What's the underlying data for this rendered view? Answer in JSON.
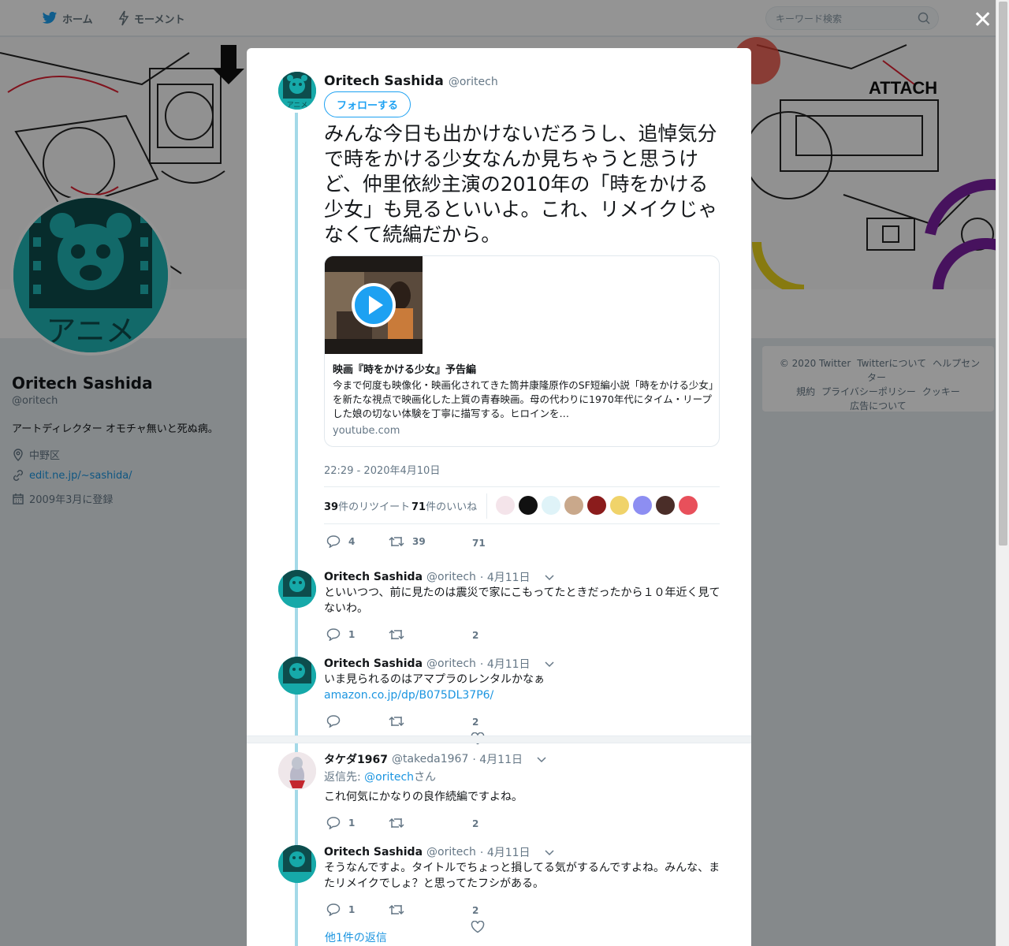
{
  "topnav": {
    "home": "ホーム",
    "moments": "モーメント",
    "search_placeholder": "キーワード検索"
  },
  "profile": {
    "name": "Oritech Sashida",
    "handle": "@oritech",
    "avatar_text": "アニメ",
    "bio": "アートディレクター オモチャ無いと死ぬ病。",
    "location": "中野区",
    "url": "edit.ne.jp/~sashida/",
    "joined": "2009年3月に登録"
  },
  "banner": {
    "label": "ATTACH"
  },
  "footer": {
    "links": [
      "© 2020 Twitter",
      "Twitterについて",
      "ヘルプセンター",
      "規約",
      "プライバシーポリシー",
      "クッキー",
      "広告について"
    ]
  },
  "tweet": {
    "name": "Oritech Sashida",
    "handle": "@oritech",
    "follow": "フォローする",
    "text": "みんな今日も出かけないだろうし、追悼気分で時をかける少女なんか見ちゃうと思うけど、仲里依紗主演の2010年の「時をかける少女」も見るといいよ。これ、リメイクじゃなくて続編だから。",
    "card": {
      "title": "映画『時をかける少女』予告編",
      "description": "今まで何度も映像化・映画化されてきた筒井康隆原作のSF短編小説「時をかける少女」を新たな視点で映画化した上質の青春映画。母の代わりに1970年代にタイム・リープした娘の切ない体験を丁寧に描写する。ヒロインを…",
      "url": "youtube.com"
    },
    "timestamp": "22:29 - 2020年4月10日",
    "retweets_count": "39",
    "retweets_label": "件のリツイート",
    "likes_count": "71",
    "likes_label": "件のいいね",
    "actions": {
      "reply": "4",
      "retweet": "39",
      "like": "71"
    }
  },
  "replies": [
    {
      "name": "Oritech Sashida",
      "handle": "@oritech",
      "date": "· 4月11日",
      "text": "といいつつ、前に見たのは震災で家にこもってたときだったから１０年近く見てないわ。",
      "reply": "1",
      "retweet": "",
      "like": "2"
    },
    {
      "name": "Oritech Sashida",
      "handle": "@oritech",
      "date": "· 4月11日",
      "text": "いま見られるのはアマプラのレンタルかなぁ",
      "link": "amazon.co.jp/dp/B075DL37P6/",
      "reply": "",
      "retweet": "",
      "like": "2"
    },
    {
      "name": "タケダ1967",
      "handle": "@takeda1967",
      "date": "· 4月11日",
      "reply_to_prefix": "返信先: ",
      "reply_to_handle": "@oritech",
      "reply_to_suffix": "さん",
      "text": "これ何気にかなりの良作続編ですよね。",
      "reply": "1",
      "retweet": "",
      "like": "2"
    },
    {
      "name": "Oritech Sashida",
      "handle": "@oritech",
      "date": "· 4月11日",
      "text": "そうなんですよ。タイトルでちょっと損してる気がするんですよね。みんな、またリメイクでしょ？と思ってたフシがある。",
      "reply": "1",
      "retweet": "",
      "like": "2"
    }
  ],
  "more_replies": "他1件の返信",
  "colors": {
    "accent": "#1da1f2",
    "teal_avatar": "#16a9a9",
    "thread_line": "#a4d9e8"
  }
}
